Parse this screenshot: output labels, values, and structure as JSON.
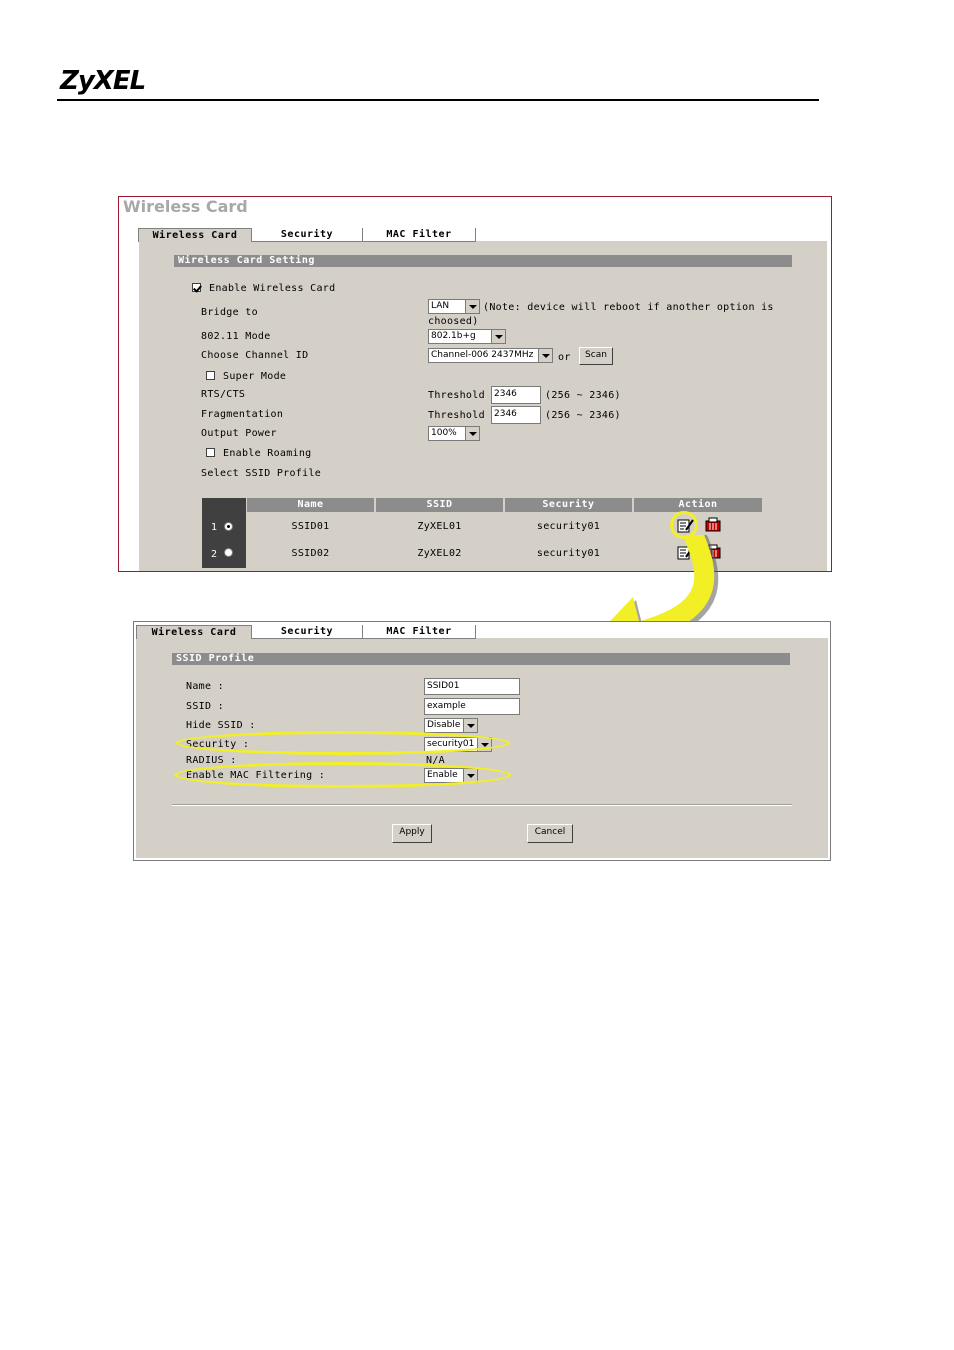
{
  "brand": {
    "logo_text": "ZyXEL"
  },
  "screen1": {
    "title": "Wireless Card",
    "tabs": [
      "Wireless Card",
      "Security",
      "MAC Filter"
    ],
    "section_title": "Wireless Card Setting",
    "enable_wireless_label": "Enable Wireless Card",
    "bridge_label": "Bridge to",
    "bridge_value": "LAN",
    "bridge_note_1": "(Note: device will reboot if another option is",
    "bridge_note_2": "choosed)",
    "mode_label": "802.11 Mode",
    "mode_value": "802.1b+g",
    "channel_label": "Choose Channel ID",
    "channel_value": "Channel-006 2437MHz",
    "or_text": "or",
    "scan_label": "Scan",
    "super_mode_label": "Super Mode",
    "rts_label": "RTS/CTS",
    "rts_threshold_label": "Threshold",
    "rts_value": "2346",
    "rts_range": "(256 ~ 2346)",
    "frag_label": "Fragmentation",
    "frag_threshold_label": "Threshold",
    "frag_value": "2346",
    "frag_range": "(256 ~ 2346)",
    "power_label": "Output Power",
    "power_value": "100%",
    "roaming_label": "Enable Roaming",
    "ssid_profile_label": "Select SSID Profile",
    "table": {
      "headers": [
        "Name",
        "SSID",
        "Security",
        "Action"
      ],
      "rows": [
        {
          "index": "1",
          "name": "SSID01",
          "ssid": "ZyXEL01",
          "security": "security01"
        },
        {
          "index": "2",
          "name": "SSID02",
          "ssid": "ZyXEL02",
          "security": "security01"
        }
      ]
    }
  },
  "screen2": {
    "tabs": [
      "Wireless Card",
      "Security",
      "MAC Filter"
    ],
    "section_title": "SSID Profile",
    "name_label": "Name :",
    "name_value": "SSID01",
    "ssid_label": "SSID :",
    "ssid_value": "example",
    "hide_ssid_label": "Hide SSID :",
    "hide_ssid_value": "Disable",
    "security_label": "Security :",
    "security_value": "security01",
    "radius_label": "RADIUS :",
    "radius_value": "N/A",
    "mac_filter_label": "Enable MAC Filtering :",
    "mac_filter_value": "Enable",
    "apply_label": "Apply",
    "cancel_label": "Cancel"
  },
  "colors": {
    "highlight": "#f2ef26",
    "frame": "#9b1b30",
    "panel": "#d4d0c8",
    "header": "#8c8c8c"
  }
}
